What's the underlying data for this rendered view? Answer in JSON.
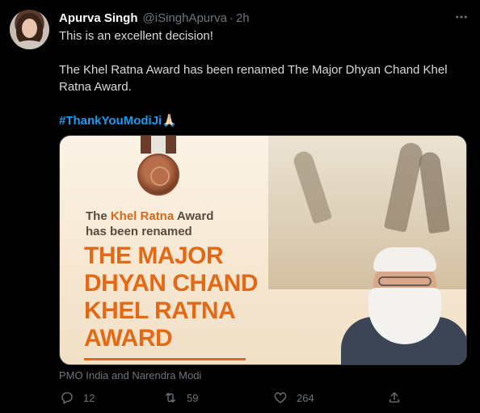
{
  "author": {
    "name": "Apurva Singh",
    "handle": "@iSinghApurva",
    "separator": "·",
    "time": "2h"
  },
  "more_icon": "more-horizontal-icon",
  "tweet": {
    "line1": "This is an excellent decision!",
    "line2": "The Khel Ratna Award has been renamed The Major Dhyan Chand Khel Ratna Award.",
    "hashtag": "#ThankYouModiJi🙏🏻"
  },
  "media": {
    "text_prefix": "The ",
    "text_highlight": "Khel Ratna",
    "text_suffix": " Award",
    "text_line2": "has been renamed",
    "big_lines": [
      "THE MAJOR",
      "DHYAN CHAND",
      "KHEL RATNA",
      "AWARD"
    ],
    "caption": "PMO India and Narendra Modi"
  },
  "actions": {
    "reply": {
      "icon": "reply-icon",
      "count": "12"
    },
    "retweet": {
      "icon": "retweet-icon",
      "count": "59"
    },
    "like": {
      "icon": "heart-icon",
      "count": "264"
    },
    "share": {
      "icon": "share-icon"
    }
  },
  "colors": {
    "background": "#000000",
    "text": "#d9d9d9",
    "muted": "#6e767d",
    "link": "#1d9bf0",
    "award_orange": "#e26a16"
  }
}
